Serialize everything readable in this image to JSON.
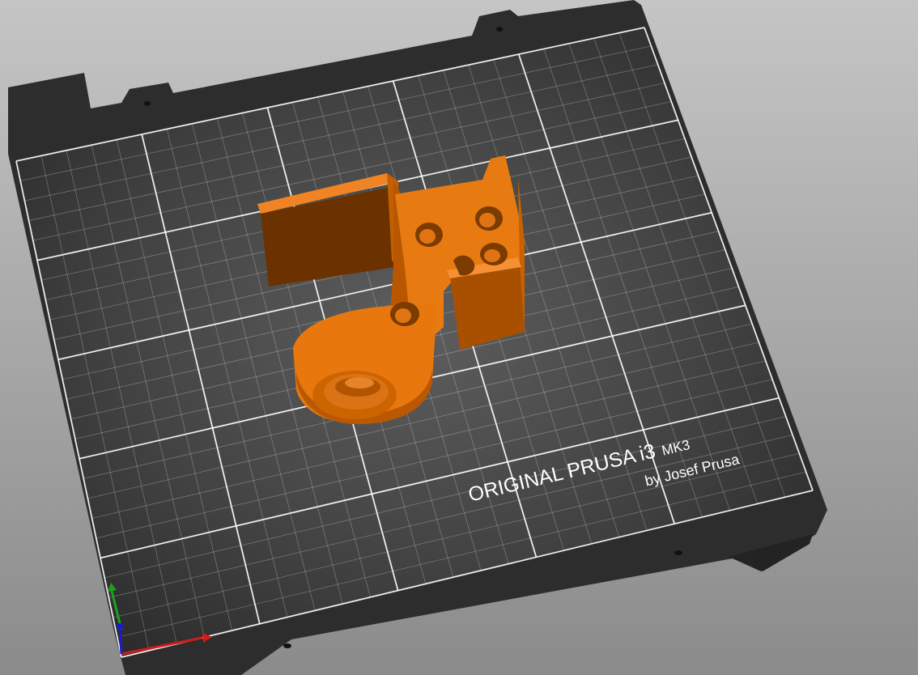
{
  "app": {
    "view": "3d-plater-view"
  },
  "colors": {
    "background_top": "#c4c4c4",
    "background_bottom": "#8a8a8a",
    "bed_frame": "#2b2b2b",
    "bed_surface_center": "#5a5a5a",
    "bed_surface_edge": "#2a2a2a",
    "grid_line": "#ffffff",
    "model": "#e06f00",
    "axis_x": "#d21a1a",
    "axis_y": "#1fa01f",
    "axis_z": "#1a1ad0"
  },
  "bed": {
    "label_line1": "ORIGINAL PRUSA i3",
    "label_model": "MK3",
    "label_line2": "by Josef Prusa"
  },
  "model": {
    "icon": "printed-part-3d"
  },
  "axes": {
    "icon": "xyz-axes-gizmo"
  }
}
